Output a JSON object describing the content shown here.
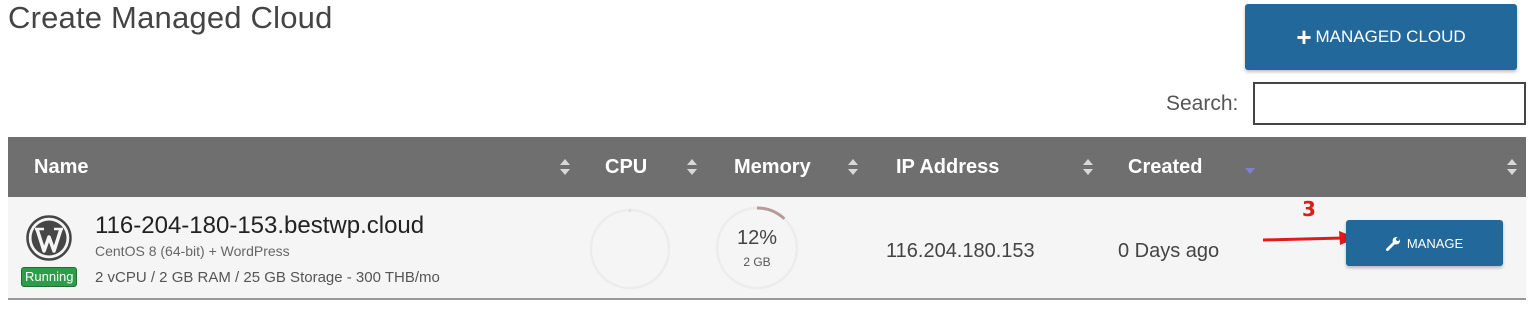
{
  "page": {
    "title": "Create Managed Cloud"
  },
  "actions": {
    "add_label": "MANAGED CLOUD"
  },
  "search": {
    "label": "Search:",
    "value": ""
  },
  "table": {
    "columns": [
      "Name",
      "CPU",
      "Memory",
      "IP Address",
      "Created"
    ],
    "rows": [
      {
        "host": "116-204-180-153.bestwp.cloud",
        "os": "CentOS 8 (64-bit) + WordPress",
        "specs": "2 vCPU / 2 GB RAM / 25 GB Storage - 300 THB/mo",
        "status": "Running",
        "cpu_percent": 0,
        "memory_percent_label": "12%",
        "memory_percent": 12,
        "memory_size": "2 GB",
        "ip": "116.204.180.153",
        "created": "0 Days ago",
        "step_number": "3",
        "manage_label": "MANAGE"
      }
    ]
  },
  "colors": {
    "header_bg": "#6f6f6f",
    "button_bg": "#23689b",
    "status_green": "#2e9c4a",
    "annotation_red": "#e01b1b",
    "memory_ring": "#b89a9a"
  }
}
